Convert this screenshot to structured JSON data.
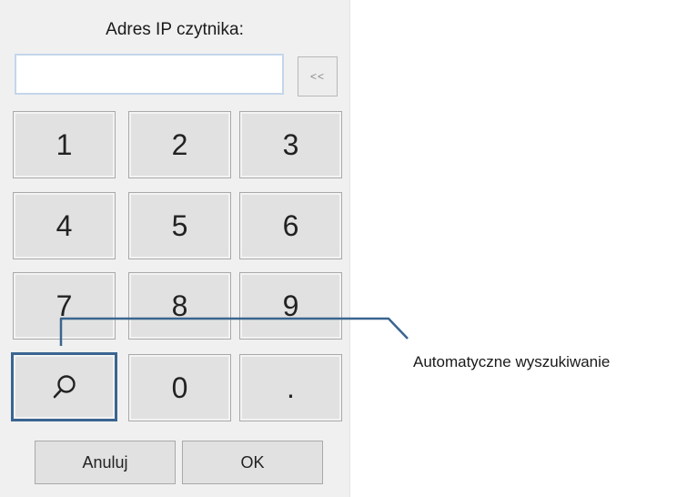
{
  "dialog": {
    "title": "Adres IP czytnika:",
    "ip_input": {
      "value": "",
      "placeholder": ""
    },
    "backspace_label": "<<"
  },
  "keypad": {
    "keys": [
      {
        "label": "1",
        "name": "key-1"
      },
      {
        "label": "2",
        "name": "key-2"
      },
      {
        "label": "3",
        "name": "key-3"
      },
      {
        "label": "4",
        "name": "key-4"
      },
      {
        "label": "5",
        "name": "key-5"
      },
      {
        "label": "6",
        "name": "key-6"
      },
      {
        "label": "7",
        "name": "key-7"
      },
      {
        "label": "8",
        "name": "key-8"
      },
      {
        "label": "9",
        "name": "key-9"
      },
      {
        "label": "",
        "name": "search-key",
        "icon": "search-icon"
      },
      {
        "label": "0",
        "name": "key-0"
      },
      {
        "label": ".",
        "name": "key-dot"
      }
    ]
  },
  "actions": {
    "cancel_label": "Anuluj",
    "ok_label": "OK"
  },
  "callout": {
    "label": "Automatyczne wyszukiwanie",
    "line_color": "#3a6590"
  }
}
